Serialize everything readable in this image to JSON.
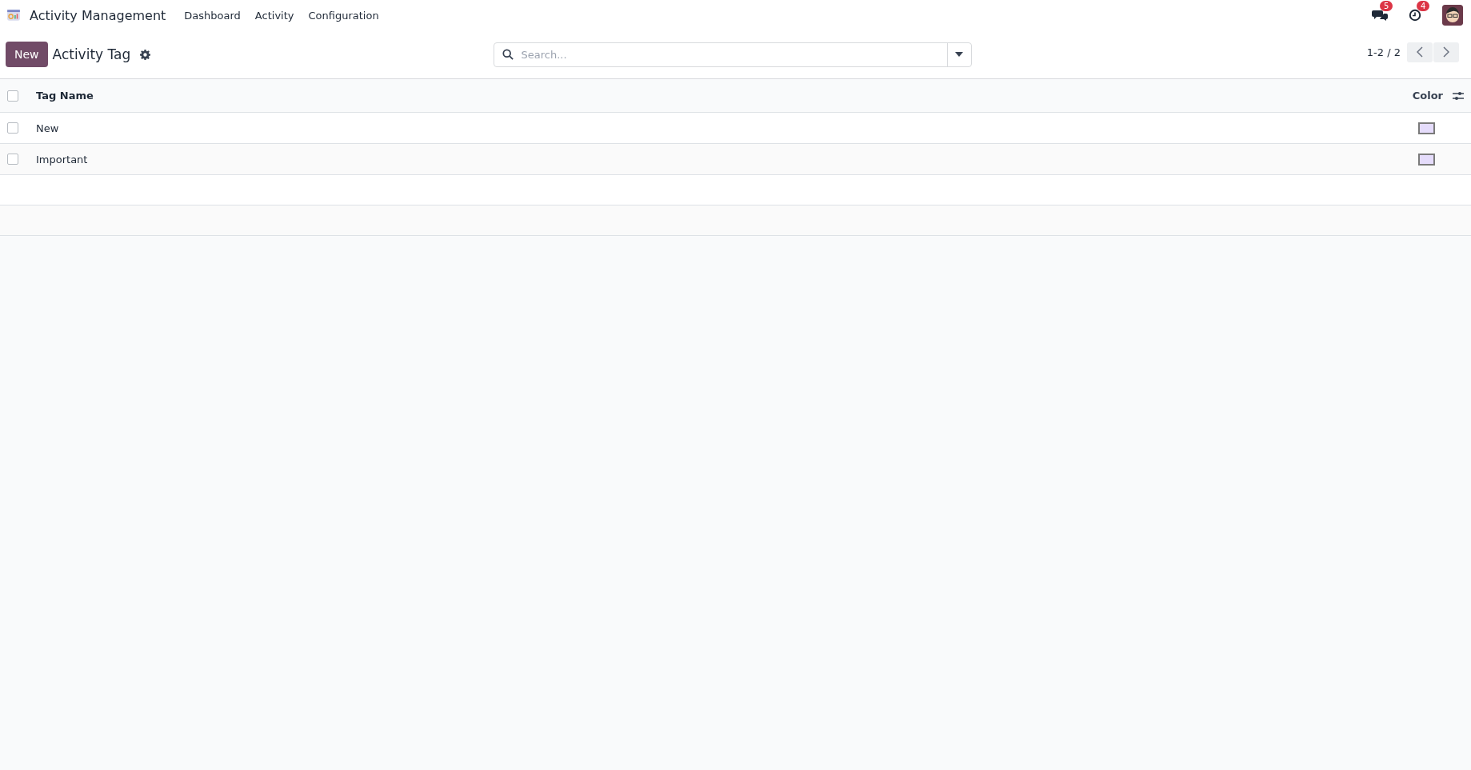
{
  "navbar": {
    "app_name": "Activity Management",
    "menu": [
      {
        "label": "Dashboard"
      },
      {
        "label": "Activity"
      },
      {
        "label": "Configuration"
      }
    ],
    "messages_badge": "5",
    "activities_badge": "4"
  },
  "control_panel": {
    "new_button": "New",
    "title": "Activity Tag",
    "search": {
      "placeholder": "Search..."
    },
    "pager": "1-2 / 2"
  },
  "table": {
    "columns": [
      {
        "label": "Tag Name"
      },
      {
        "label": "Color"
      }
    ],
    "header_checked": false,
    "rows": [
      {
        "name": "New",
        "checked": false,
        "color": "#e5dcfb"
      },
      {
        "name": "Important",
        "checked": false,
        "color": "#e5dcfb"
      }
    ]
  }
}
